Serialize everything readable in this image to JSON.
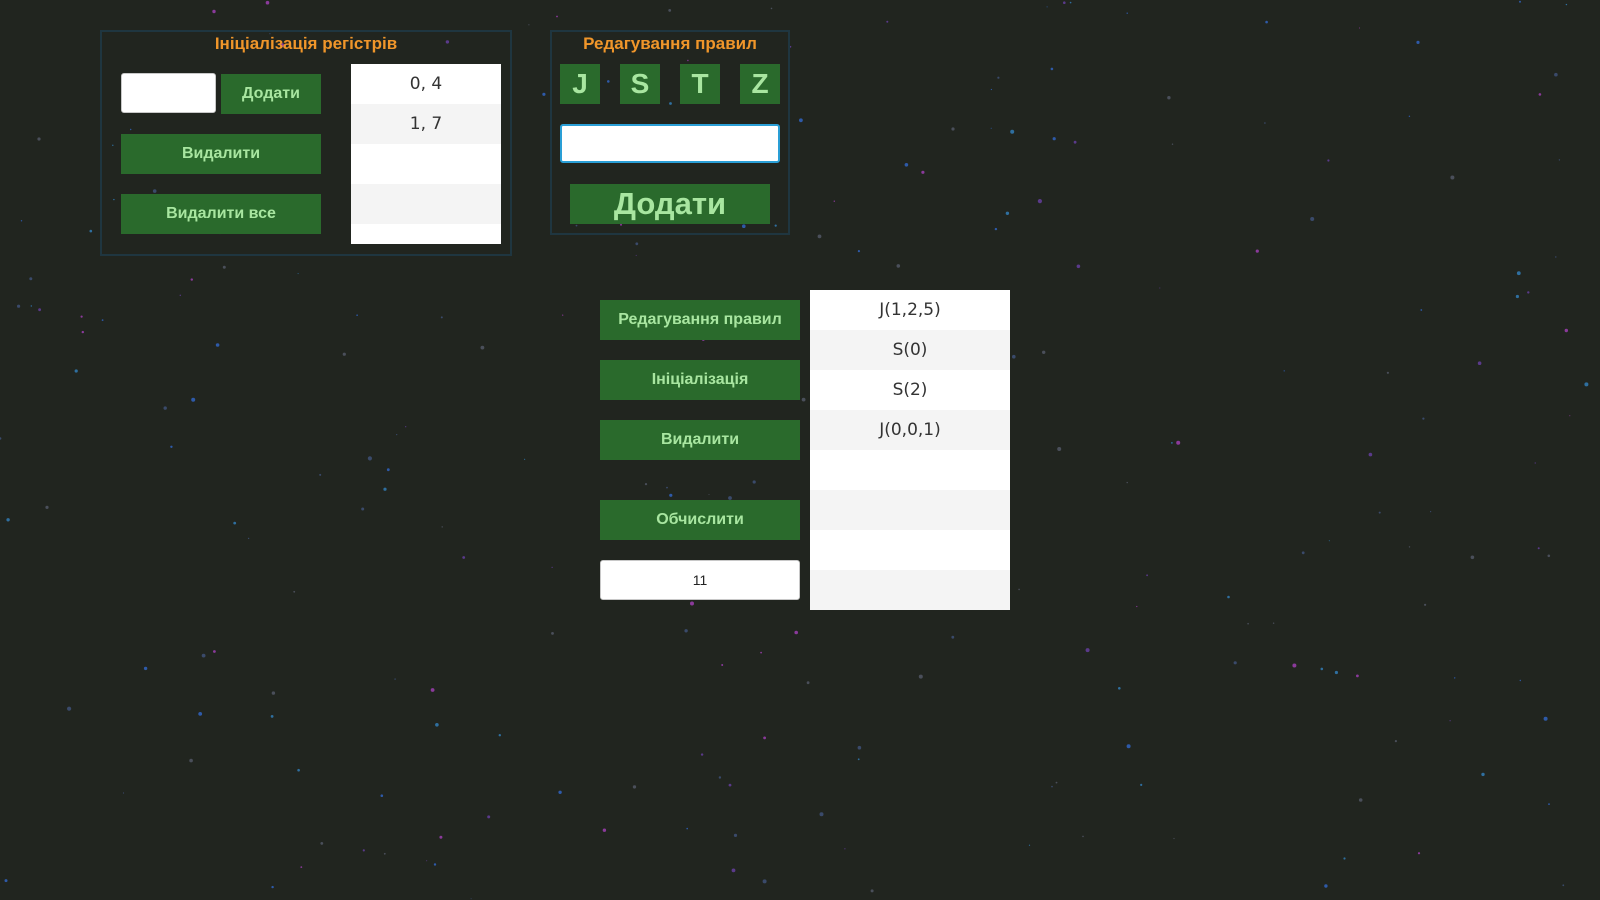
{
  "colors": {
    "background": "#21251f",
    "button": "#2a6a2c",
    "button_text": "#a8e6a0",
    "title": "#f0962a",
    "panel_border": "#1f3640"
  },
  "register_panel": {
    "title": "Ініціалізація регістрів",
    "input_value": "",
    "add_label": "Додати",
    "delete_label": "Видалити",
    "delete_all_label": "Видалити все",
    "items": [
      "0, 4",
      "1, 7",
      "",
      "",
      ""
    ]
  },
  "rules_panel": {
    "title": "Редагування правил",
    "letters": [
      "J",
      "S",
      "T",
      "Z"
    ],
    "input_value": "",
    "add_label": "Додати"
  },
  "main": {
    "edit_rules_label": "Редагування правил",
    "init_label": "Ініціалізація",
    "delete_label": "Видалити",
    "compute_label": "Обчислити",
    "result_value": "11",
    "program": [
      "J(1,2,5)",
      "S(0)",
      "S(2)",
      "J(0,0,1)",
      "",
      "",
      "",
      ""
    ]
  }
}
